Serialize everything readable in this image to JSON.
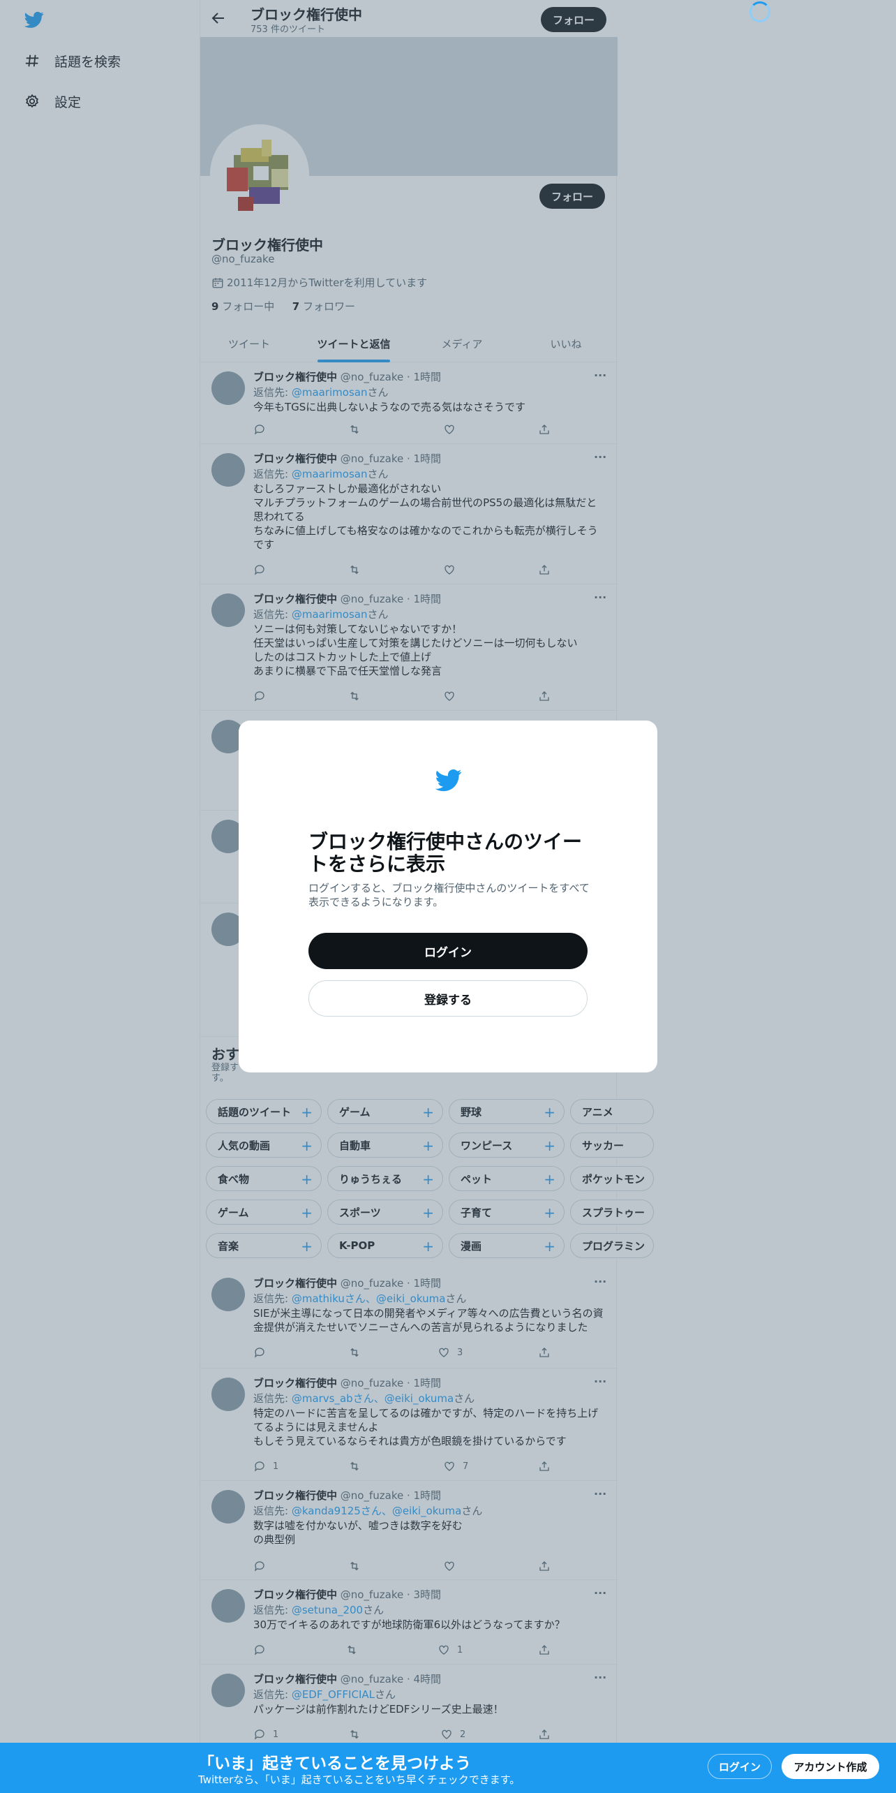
{
  "nav": {
    "logo_icon": "twitter-bird-icon",
    "items": [
      {
        "label": "話題を検索",
        "icon": "hashtag-icon"
      },
      {
        "label": "設定",
        "icon": "gear-icon"
      }
    ]
  },
  "header": {
    "name": "ブロック権行使中",
    "tweet_count": "753 件のツイート",
    "follow_label": "フォロー"
  },
  "profile": {
    "name": "ブロック権行使中",
    "handle": "@no_fuzake",
    "joined": "2011年12月からTwitterを利用しています",
    "following_count": "9",
    "following_label": " フォロー中",
    "followers_count": "7",
    "followers_label": " フォロワー",
    "follow_label": "フォロー"
  },
  "tabs": [
    "ツイート",
    "ツイートと返信",
    "メディア",
    "いいね"
  ],
  "tweets": [
    {
      "name": "ブロック権行使中",
      "meta": " @no_fuzake · 1時間",
      "reply_prefix": "返信先: ",
      "reply_to": "@maarimosan",
      "reply_suffix": "さん",
      "text": "今年もTGSに出典しないようなので売る気はなさそうです",
      "reply_count": "",
      "like_count": ""
    },
    {
      "name": "ブロック権行使中",
      "meta": " @no_fuzake · 1時間",
      "reply_prefix": "返信先: ",
      "reply_to": "@maarimosan",
      "reply_suffix": "さん",
      "text": "むしろファーストしか最適化がされない\nマルチプラットフォームのゲームの場合前世代のPS5の最適化は無駄だと思われてる\nちなみに値上げしても格安なのは確かなのでこれからも転売が横行しそうです",
      "reply_count": "",
      "like_count": ""
    },
    {
      "name": "ブロック権行使中",
      "meta": " @no_fuzake · 1時間",
      "reply_prefix": "返信先: ",
      "reply_to": "@maarimosan",
      "reply_suffix": "さん",
      "text": "ソニーは何も対策してないじゃないですか！\n任天堂はいっぱい生産して対策を講じたけどソニーは一切何もしない\nしたのはコストカットした上で値上げ\nあまりに横暴で下品で任天堂憎しな発言",
      "reply_count": "",
      "like_count": ""
    },
    {
      "name": "ブロック権行使中",
      "meta": " @no_fuzake · 1時間",
      "reply_prefix": "返信先: ",
      "reply_to": "@mathikuさん、@eiki_okuma",
      "reply_suffix": "さん",
      "text": "SIEが米主導になって日本の開発者やメディア等々への広告費という名の資金提供が消えたせいでソニーさんへの苦言が見られるようになりました",
      "reply_count": "",
      "like_count": "3"
    },
    {
      "name": "ブロック権行使中",
      "meta": " @no_fuzake · 1時間",
      "reply_prefix": "返信先: ",
      "reply_to": "@marvs_abさん、@eiki_okuma",
      "reply_suffix": "さん",
      "text": "特定のハードに苦言を呈してるのは確かですが、特定のハードを持ち上げてるようには見えませんよ\nもしそう見えているならそれは貴方が色眼鏡を掛けているからです",
      "reply_count": "1",
      "like_count": "7"
    },
    {
      "name": "ブロック権行使中",
      "meta": " @no_fuzake · 1時間",
      "reply_prefix": "返信先: ",
      "reply_to": "@kanda9125さん、@eiki_okuma",
      "reply_suffix": "さん",
      "text": "数字は嘘を付かないが、嘘つきは数字を好む\nの典型例",
      "reply_count": "",
      "like_count": ""
    },
    {
      "name": "ブロック権行使中",
      "meta": " @no_fuzake · 3時間",
      "reply_prefix": "返信先: ",
      "reply_to": "@setuna_200",
      "reply_suffix": "さん",
      "text": "30万でイキるのあれですが地球防衛軍6以外はどうなってますか？",
      "reply_count": "",
      "like_count": "1"
    },
    {
      "name": "ブロック権行使中",
      "meta": " @no_fuzake · 4時間",
      "reply_prefix": "返信先: ",
      "reply_to": "@EDF_OFFICIAL",
      "reply_suffix": "さん",
      "text": "パッケージは前作割れたけどEDFシリーズ史上最速！",
      "reply_count": "1",
      "like_count": "2"
    }
  ],
  "topics": {
    "title": "おす",
    "subtitle": "登録す\nす。",
    "rows": [
      [
        "話題のツイート",
        "ゲーム",
        "野球",
        "アニメ"
      ],
      [
        "人気の動画",
        "自動車",
        "ワンピース",
        "サッカー"
      ],
      [
        "食べ物",
        "りゅうちぇる",
        "ペット",
        "ポケットモン"
      ],
      [
        "ゲーム",
        "スポーツ",
        "子育て",
        "スプラトゥー"
      ],
      [
        "音楽",
        "K-POP",
        "漫画",
        "プログラミン"
      ]
    ]
  },
  "modal": {
    "logo_icon": "twitter-bird-icon",
    "title": "ブロック権行使中さんのツイートをさらに表示",
    "description": "ログインすると、ブロック権行使中さんのツイートをすべて表示できるようになります。",
    "login_label": "ログイン",
    "signup_label": "登録する"
  },
  "bottom_bar": {
    "title": "「いま」起きていることを見つけよう",
    "subtitle": "Twitterなら、「いま」起きていることをいち早くチェックできます。",
    "login_label": "ログイン",
    "signup_label": "アカウント作成"
  },
  "colors": {
    "accent": "#1d9bf0",
    "text": "#0f1419",
    "secondary": "#536471",
    "overlay": "rgba(91,112,131,0.4)"
  }
}
